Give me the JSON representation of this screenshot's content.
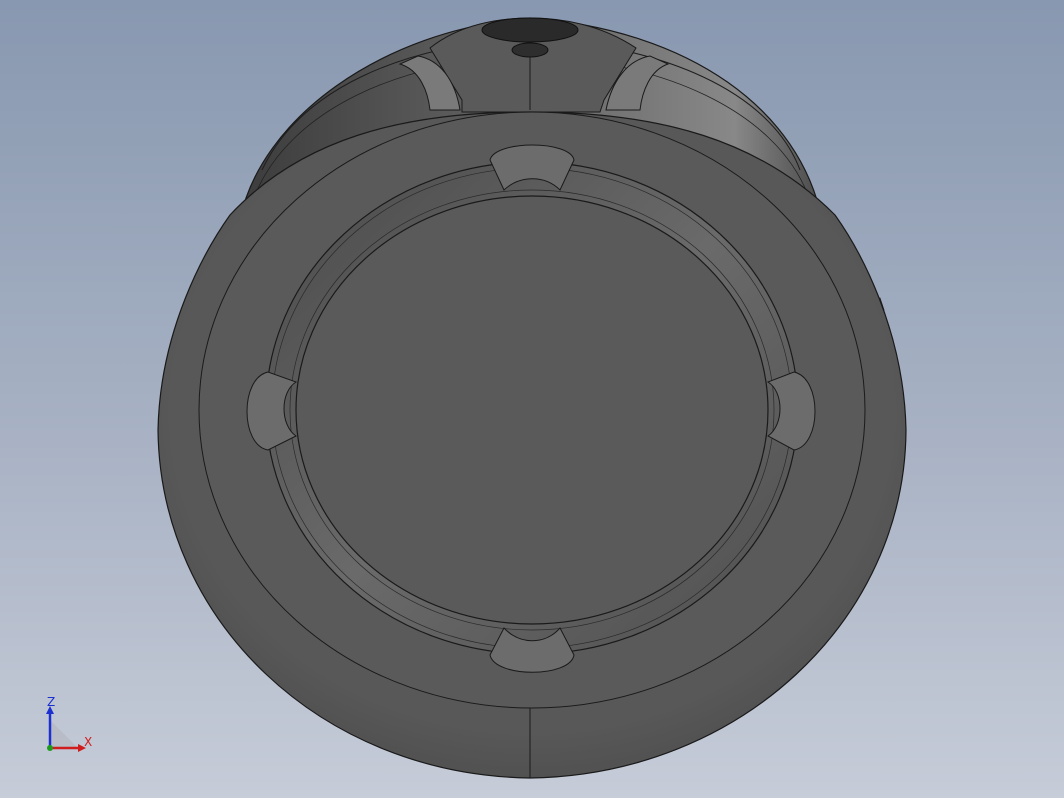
{
  "viewport": {
    "background_top": "#8898b0",
    "background_bottom": "#c6ccd8"
  },
  "model": {
    "body_color": "#5c5c5c",
    "edge_color": "#1a1a1a"
  },
  "triad": {
    "z_label": "Z",
    "x_label": "X",
    "z_color": "#1c2fd0",
    "x_color": "#d01c1c",
    "origin_color": "#1c9c1c"
  }
}
